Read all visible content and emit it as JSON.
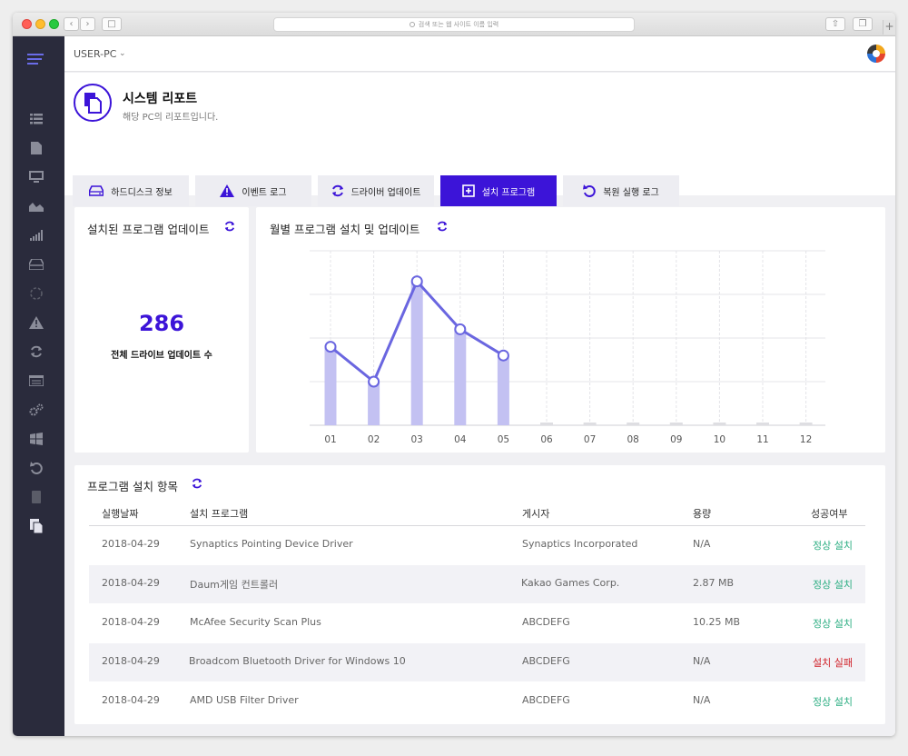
{
  "browser": {
    "url_placeholder": "검색 또는 웹 사이트 이름 입력"
  },
  "topbar": {
    "pc_name": "USER-PC"
  },
  "header": {
    "title": "시스템 리포트",
    "subtitle": "해당 PC의 리포트입니다."
  },
  "tabs": [
    {
      "label": "하드디스크 정보",
      "icon": "hdd-icon"
    },
    {
      "label": "이벤트 로그",
      "icon": "warning-icon"
    },
    {
      "label": "드라이버 업데이트",
      "icon": "refresh-icon"
    },
    {
      "label": "설치 프로그램",
      "icon": "plus-box-icon"
    },
    {
      "label": "복원 실행 로그",
      "icon": "restore-icon"
    }
  ],
  "active_tab": "설치 프로그램",
  "update_card": {
    "title": "설치된 프로그램 업데이트",
    "count": "286",
    "count_label": "전체 드라이브 업데이트 수"
  },
  "chart_card": {
    "title": "월별 프로그램 설치 및 업데이트"
  },
  "chart_data": {
    "type": "bar",
    "overlay": "line",
    "categories": [
      "01",
      "02",
      "03",
      "04",
      "05",
      "06",
      "07",
      "08",
      "09",
      "10",
      "11",
      "12"
    ],
    "values": [
      18,
      10,
      33,
      22,
      16,
      0,
      0,
      0,
      0,
      0,
      0,
      0
    ],
    "line_values": [
      18,
      10,
      33,
      22,
      16
    ],
    "ylim": [
      0,
      40
    ],
    "grid": true,
    "bar_color": "#c3c1f2",
    "line_color": "#6a66e0"
  },
  "table_card": {
    "title": "프로그램 설치 항목",
    "columns": [
      "실행날짜",
      "설치 프로그램",
      "게시자",
      "용량",
      "성공여부"
    ],
    "rows": [
      [
        "2018-04-29",
        "Synaptics Pointing Device Driver",
        "Synaptics Incorporated",
        "N/A",
        "정상 설치"
      ],
      [
        "2018-04-29",
        "Daum게임 컨트롤러",
        "Kakao Games Corp.",
        "2.87 MB",
        "정상 설치"
      ],
      [
        "2018-04-29",
        "McAfee Security Scan Plus",
        "ABCDEFG",
        "10.25 MB",
        "정상 설치"
      ],
      [
        "2018-04-29",
        "Broadcom Bluetooth Driver for Windows 10",
        "ABCDEFG",
        "N/A",
        "설치 실패"
      ],
      [
        "2018-04-29",
        "AMD USB Filter Driver",
        "ABCDEFG",
        "N/A",
        "정상 설치"
      ]
    ]
  },
  "colors": {
    "accent": "#3c14d8",
    "sidebar": "#2a2b3c",
    "success": "#2dae83",
    "fail": "#d01f26"
  }
}
